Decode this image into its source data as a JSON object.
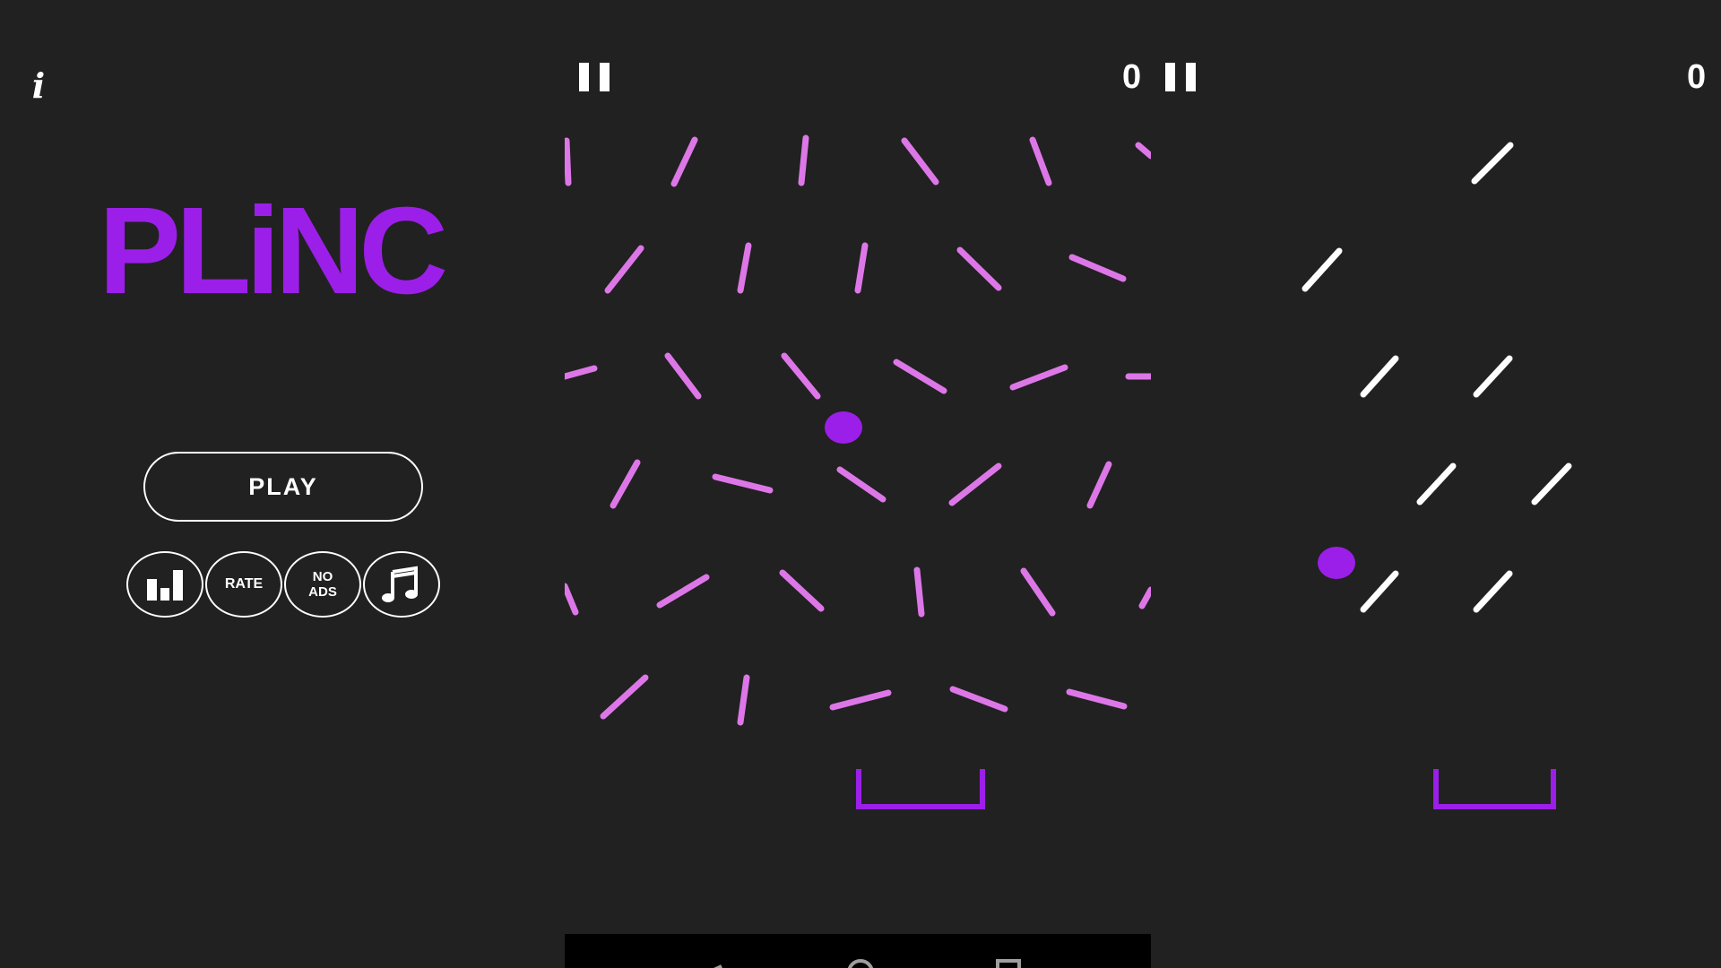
{
  "header": {
    "info_icon": "info-icon",
    "info_glyph": "i",
    "pause_icon": "pause-icon"
  },
  "menu": {
    "logo_text": "PLiNC",
    "play_label": "PLAY",
    "leaderboard_icon": "bar-chart-icon",
    "rate_label": "RATE",
    "no_ads_line1": "NO",
    "no_ads_line2": "ADS",
    "music_icon": "music-note-icon"
  },
  "game_left": {
    "score": "0",
    "peg_color": "#dd77e8",
    "ball_color": "#9b1fe8",
    "bucket_color": "#9b1fe8"
  },
  "game_right": {
    "score": "0",
    "peg_color": "#ffffff",
    "ball_color": "#9b1fe8",
    "bucket_color": "#9b1fe8"
  },
  "colors": {
    "background": "#212121",
    "accent": "#9b1fe8",
    "nav_bar": "#000000"
  },
  "nav_bar": {
    "icons": [
      "back-icon",
      "home-icon",
      "recents-icon"
    ]
  }
}
